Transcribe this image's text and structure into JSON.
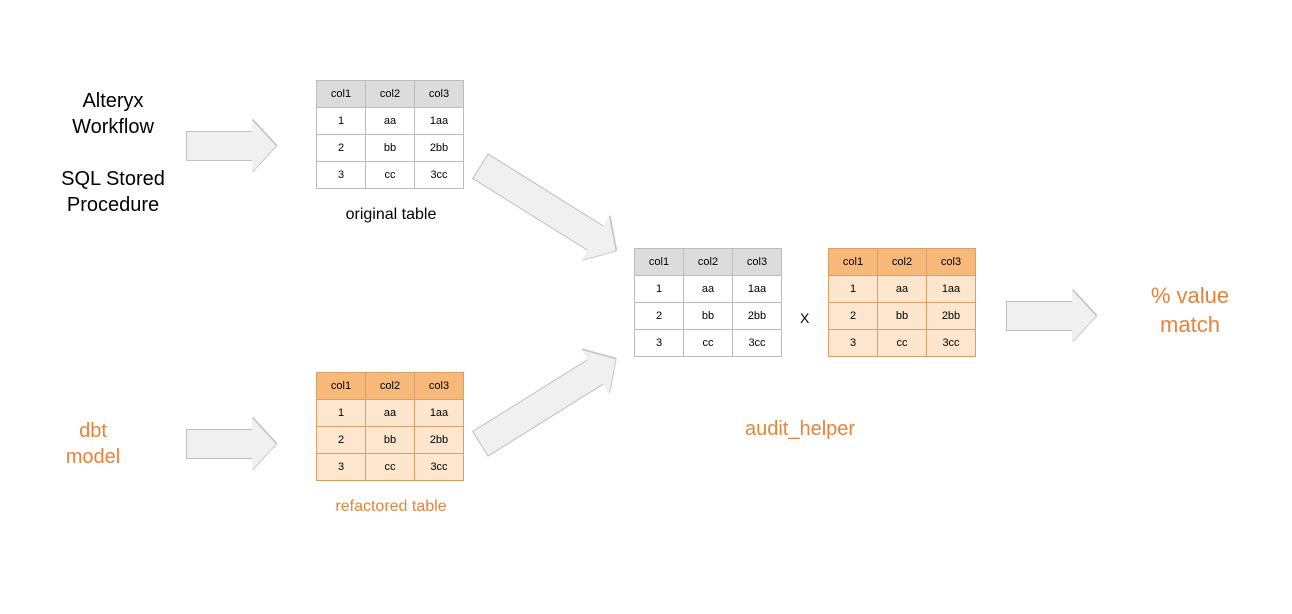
{
  "labels": {
    "input_top": "Alteryx\nWorkflow\n\nSQL Stored\nProcedure",
    "input_bottom": "dbt\nmodel",
    "caption_original": "original table",
    "caption_refactored": "refactored table",
    "caption_audit": "audit_helper",
    "output": "% value\nmatch",
    "x": "X"
  },
  "table": {
    "headers": [
      "col1",
      "col2",
      "col3"
    ],
    "rows": [
      [
        "1",
        "aa",
        "1aa"
      ],
      [
        "2",
        "bb",
        "2bb"
      ],
      [
        "3",
        "cc",
        "3cc"
      ]
    ]
  }
}
